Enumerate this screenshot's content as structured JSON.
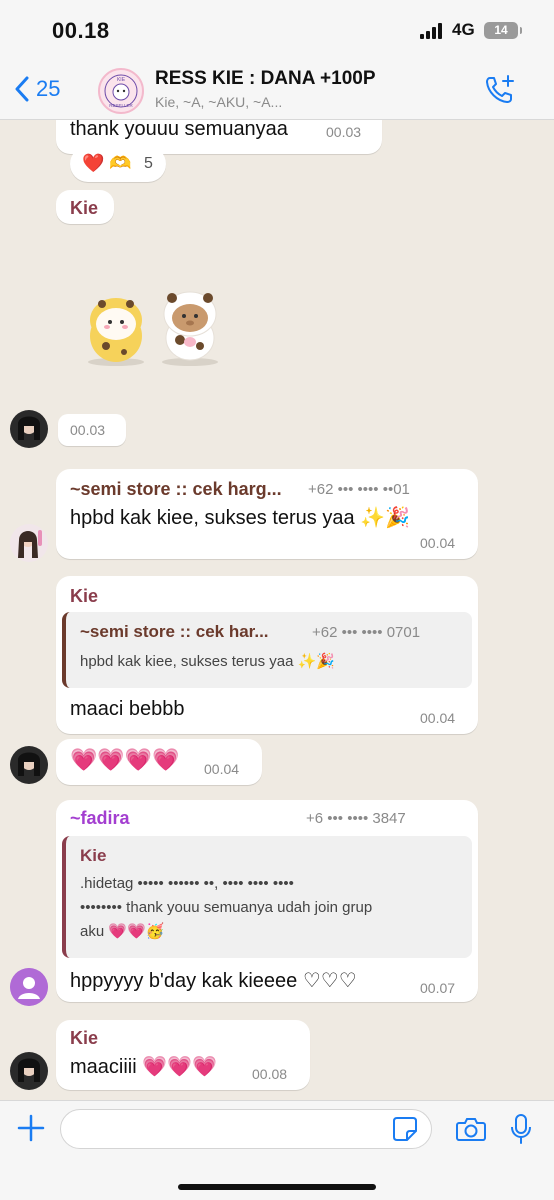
{
  "status": {
    "time": "00.18",
    "network": "4G",
    "battery": "14"
  },
  "header": {
    "back_count": "25",
    "avatar_text": "KIE RESELLER",
    "title": "RESS KIE : DANA +100P",
    "members": "Kie, ~A, ~AKU, ~A..."
  },
  "messages": {
    "m1": {
      "text": "thank youuu semuanyaa",
      "time": "00.03"
    },
    "reactions": {
      "emojis": "❤️ 🫶",
      "count": "5"
    },
    "m2": {
      "sender": "Kie"
    },
    "sticker_time": "00.03",
    "m3": {
      "sender": "~semi store :: cek harg...",
      "phone": "+62 ••• •••• ••01",
      "text": "hpbd kak kiee, sukses terus yaa ✨🎉",
      "time": "00.04"
    },
    "m4": {
      "sender": "Kie",
      "quote_sender": "~semi store :: cek har...",
      "quote_phone": "+62 ••• •••• 0701",
      "quote_text": "hpbd kak kiee, sukses terus yaa ✨🎉",
      "text": "maaci bebbb",
      "time": "00.04"
    },
    "m5": {
      "text": "💗💗💗💗",
      "time": "00.04"
    },
    "m6": {
      "sender": "~fadira",
      "phone": "+6 ••• •••• 3847",
      "quote_sender": "Kie",
      "quote_line1": ".hidetag ••••• •••••• ••, •••• •••• ••••",
      "quote_line2": "•••••••• thank youu semuanya udah join grup",
      "quote_line3": "aku 💗💗🥳",
      "text": "hppyyyy b'day kak kieeee ♡♡♡",
      "time": "00.07"
    },
    "m7": {
      "sender": "Kie",
      "text": "maaciiii 💗💗💗",
      "time": "00.08"
    }
  },
  "input": {
    "placeholder": ""
  }
}
